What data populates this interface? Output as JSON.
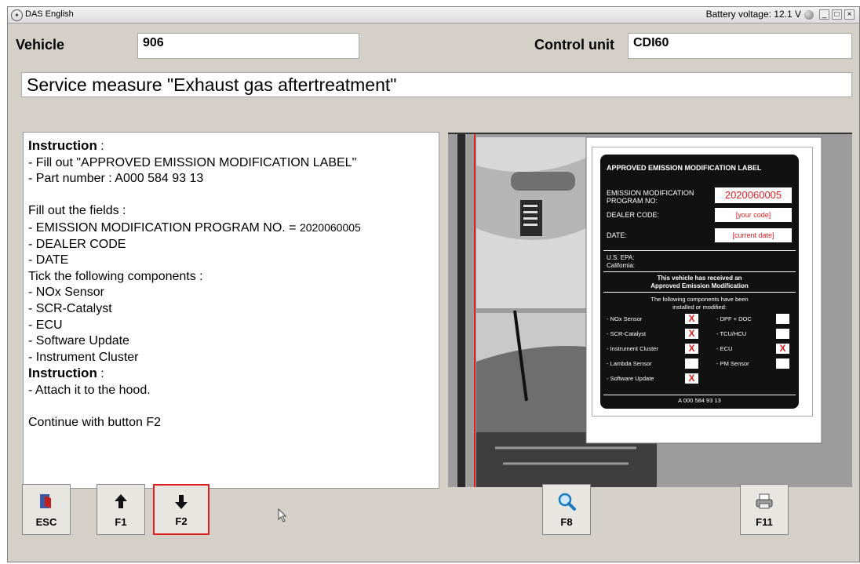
{
  "window": {
    "title": "DAS English",
    "battery": "Battery voltage: 12.1 V",
    "controls": [
      "_",
      "□",
      "×"
    ]
  },
  "vehicle": {
    "label": "Vehicle",
    "value": "906"
  },
  "control_unit": {
    "label": "Control unit",
    "value": "CDI60"
  },
  "measure": "Service measure \"Exhaust gas aftertreatment\"",
  "instructions": [
    {
      "text": "Instruction",
      "bold": true,
      "suffix": " :"
    },
    {
      "text": "- Fill out \"APPROVED EMISSION MODIFICATION LABEL\""
    },
    {
      "text": "- Part number : A000 584 93 13"
    },
    {
      "text": ""
    },
    {
      "text": "Fill out the fields :"
    },
    {
      "text": "- EMISSION MODIFICATION PROGRAM NO. = ",
      "small": "2020060005"
    },
    {
      "text": "- DEALER CODE"
    },
    {
      "text": "- DATE"
    },
    {
      "text": "Tick the following components :"
    },
    {
      "text": "- NOx Sensor"
    },
    {
      "text": "- SCR-Catalyst"
    },
    {
      "text": "- ECU"
    },
    {
      "text": "- Software Update"
    },
    {
      "text": "- Instrument Cluster"
    },
    {
      "text": "Instruction",
      "bold": true,
      "suffix": " :"
    },
    {
      "text": "- Attach it to the hood."
    },
    {
      "text": ""
    },
    {
      "text": "Continue with button F2"
    }
  ],
  "label_card": {
    "heading": "APPROVED EMISSION MODIFICATION LABEL",
    "prog_label": "EMISSION MODIFICATION PROGRAM NO:",
    "prog_value": "2020060005",
    "dealer_label": "DEALER CODE:",
    "dealer_value": "[your code]",
    "date_label": "DATE:",
    "date_value": "[current date]",
    "epa": "U.S. EPA:",
    "california": "California:",
    "received_1": "This vehicle has received an",
    "received_2": "Approved Emission Modification",
    "following_1": "The following components have been",
    "following_2": "installed or modified:",
    "components": [
      {
        "name": "- NOx Sensor",
        "checked": true
      },
      {
        "name": "- DPF + DOC",
        "checked": false
      },
      {
        "name": "- SCR-Catalyst",
        "checked": true
      },
      {
        "name": "- TCU/HCU",
        "checked": false
      },
      {
        "name": "- Instrument Cluster",
        "checked": true
      },
      {
        "name": "- ECU",
        "checked": true
      },
      {
        "name": "- Lambda Sensor",
        "checked": false
      },
      {
        "name": "- PM Sensor",
        "checked": false
      },
      {
        "name": "- Software Update",
        "checked": true
      }
    ],
    "mark": "X",
    "part_no": "A 000 584 93 13"
  },
  "buttons": {
    "esc": "ESC",
    "f1": "F1",
    "f2": "F2",
    "f8": "F8",
    "f11": "F11"
  },
  "colors": {
    "highlight": "#e02020",
    "label_bg": "#111111"
  }
}
